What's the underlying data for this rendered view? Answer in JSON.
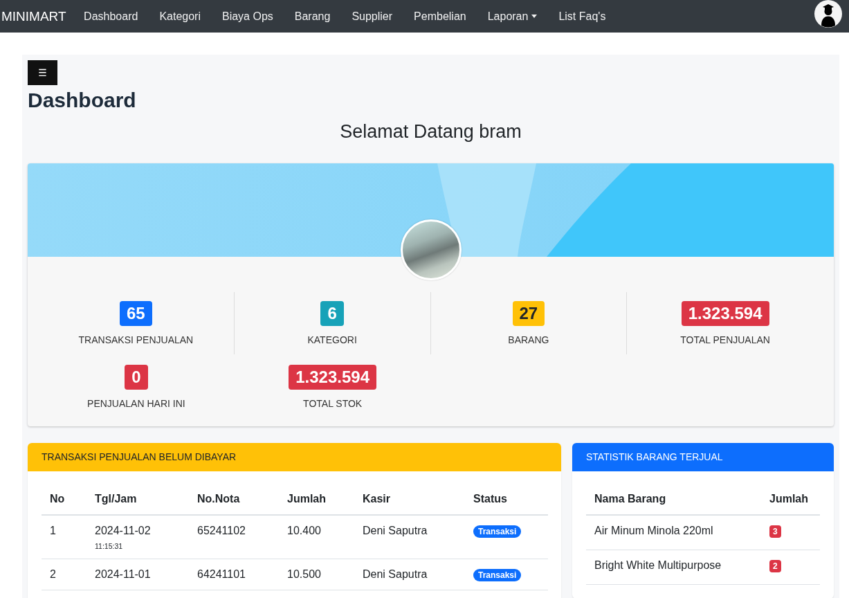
{
  "navbar": {
    "brand": "MINIMART",
    "links": [
      {
        "label": "Dashboard",
        "kind": "link"
      },
      {
        "label": "Kategori",
        "kind": "link"
      },
      {
        "label": "Biaya Ops",
        "kind": "link"
      },
      {
        "label": "Barang",
        "kind": "link"
      },
      {
        "label": "Supplier",
        "kind": "link"
      },
      {
        "label": "Pembelian",
        "kind": "link"
      },
      {
        "label": "Laporan",
        "kind": "dropdown"
      },
      {
        "label": "List Faq's",
        "kind": "link"
      }
    ]
  },
  "page": {
    "menu_button": "☰",
    "title": "Dashboard",
    "welcome": "Selamat Datang bram"
  },
  "stats": [
    {
      "value": "65",
      "label": "TRANSAKSI PENJUALAN",
      "color": "#0d6efd"
    },
    {
      "value": "6",
      "label": "KATEGORI",
      "color": "#17a2b8"
    },
    {
      "value": "27",
      "label": "BARANG",
      "color": "#ffc107"
    },
    {
      "value": "1.323.594",
      "label": "TOTAL PENJUALAN",
      "color": "#dc3545"
    },
    {
      "value": "0",
      "label": "PENJUALAN HARI INI",
      "color": "#dc3545"
    },
    {
      "value": "1.323.594",
      "label": "TOTAL STOK",
      "color": "#dc3545"
    }
  ],
  "unpaid_sales": {
    "title": "TRANSAKSI PENJUALAN BELUM DIBAYAR",
    "columns": [
      "No",
      "Tgl/Jam",
      "No.Nota",
      "Jumlah",
      "Kasir",
      "Status"
    ],
    "rows": [
      {
        "no": "1",
        "date": "2024-11-02",
        "time": "11:15:31",
        "nota": "65241102",
        "amount": "10.400",
        "cashier": "Deni Saputra",
        "status": "Transaksi"
      },
      {
        "no": "2",
        "date": "2024-11-01",
        "nota": "64241101",
        "amount": "10.500",
        "cashier": "Deni Saputra",
        "status": "Transaksi"
      }
    ]
  },
  "items_sold": {
    "title": "STATISTIK BARANG TERJUAL",
    "columns": [
      "Nama Barang",
      "Jumlah"
    ],
    "rows": [
      {
        "name": "Air Minum Minola 220ml",
        "count": "3"
      },
      {
        "name": "Bright White Multipurpose",
        "count": "2"
      }
    ]
  }
}
